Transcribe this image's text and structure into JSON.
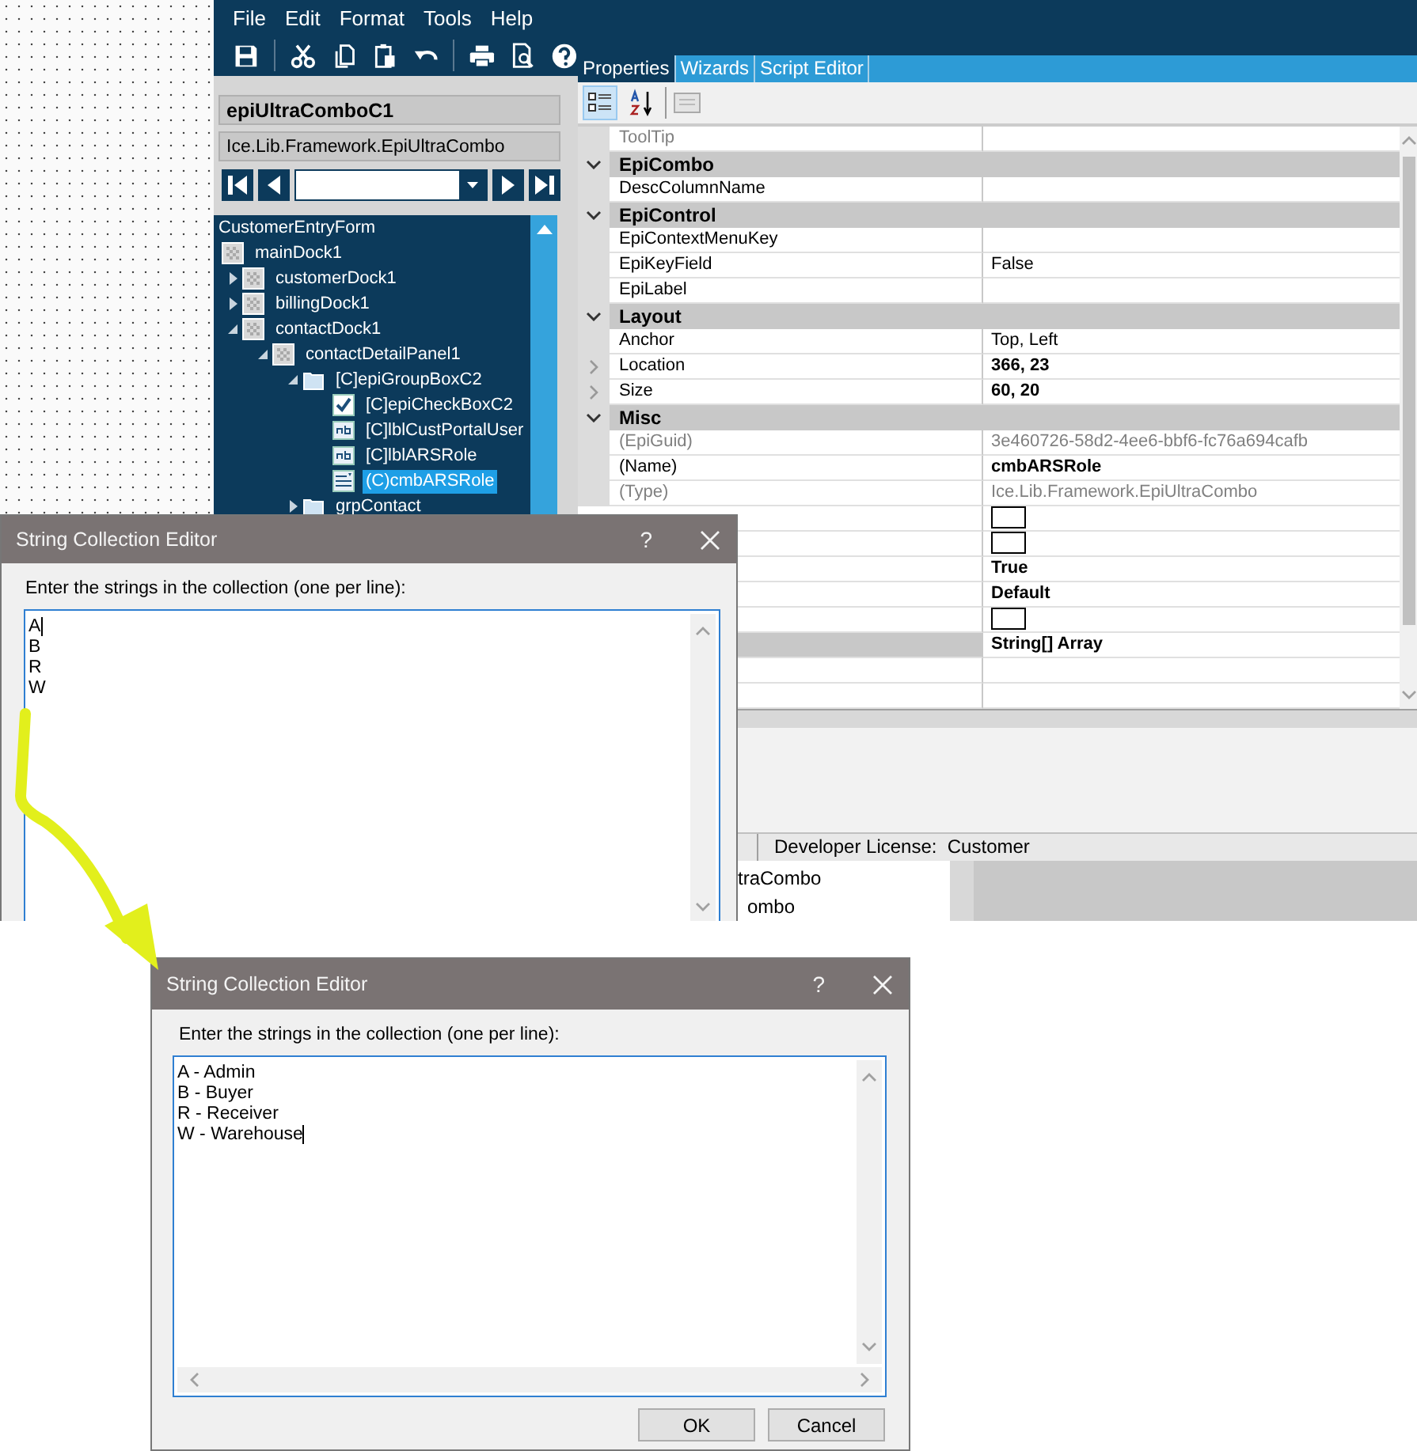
{
  "main_window": {
    "menu": [
      "File",
      "Edit",
      "Format",
      "Tools",
      "Help"
    ],
    "control_name": "epiUltraComboC1",
    "control_type": "Ice.Lib.Framework.EpiUltraCombo",
    "tree": [
      {
        "label": "CustomerEntryForm",
        "selected": false,
        "children": [
          {
            "label": "mainDock1",
            "kind": "dock",
            "selected": false,
            "children": [
              {
                "label": "customerDock1",
                "kind": "dock",
                "expanded": false,
                "selected": false
              },
              {
                "label": "billingDock1",
                "kind": "dock",
                "expanded": false,
                "selected": false
              },
              {
                "label": "contactDock1",
                "kind": "dock",
                "expanded": true,
                "selected": false,
                "children": [
                  {
                    "label": "contactDetailPanel1",
                    "kind": "dock",
                    "expanded": true,
                    "selected": false,
                    "children": [
                      {
                        "label": "[C]epiGroupBoxC2",
                        "kind": "group",
                        "expanded": true,
                        "selected": false,
                        "children": [
                          {
                            "label": "[C]epiCheckBoxC2",
                            "kind": "checkbox",
                            "selected": false
                          },
                          {
                            "label": "[C]lblCustPortalUser",
                            "kind": "label",
                            "selected": false
                          },
                          {
                            "label": "[C]lblARSRole",
                            "kind": "label",
                            "selected": false
                          },
                          {
                            "label": "(C)cmbARSRole",
                            "kind": "combo",
                            "selected": true
                          }
                        ]
                      },
                      {
                        "label": "grpContact",
                        "kind": "group",
                        "expanded": false,
                        "selected": false
                      }
                    ]
                  }
                ]
              }
            ]
          }
        ]
      }
    ],
    "tabs": [
      {
        "label": "Properties",
        "selected": true
      },
      {
        "label": "Wizards",
        "selected": false
      },
      {
        "label": "Script Editor",
        "selected": false
      }
    ],
    "view_buttons": [
      {
        "kind": "categorized",
        "selected": true
      },
      {
        "kind": "alphabetical",
        "selected": false
      }
    ],
    "properties": [
      {
        "kind": "property",
        "name": "ToolTip",
        "readonly": true,
        "expandable": false,
        "selected": false
      },
      {
        "kind": "category",
        "name": "EpiCombo",
        "expanded": true
      },
      {
        "kind": "property",
        "name": "DescColumnName",
        "readonly": false,
        "expandable": false,
        "selected": false
      },
      {
        "kind": "category",
        "name": "EpiControl",
        "expanded": true
      },
      {
        "kind": "property",
        "name": "EpiContextMenuKey",
        "readonly": false,
        "expandable": false,
        "selected": false
      },
      {
        "kind": "property",
        "name": "EpiKeyField",
        "value": "False",
        "readonly": false,
        "modified": false,
        "expandable": false,
        "selected": false
      },
      {
        "kind": "property",
        "name": "EpiLabel",
        "readonly": false,
        "expandable": false,
        "selected": false
      },
      {
        "kind": "category",
        "name": "Layout",
        "expanded": true
      },
      {
        "kind": "property",
        "name": "Anchor",
        "value": "Top, Left",
        "readonly": false,
        "modified": false,
        "expandable": false,
        "selected": false
      },
      {
        "kind": "property",
        "name": "Location",
        "value": "366, 23",
        "readonly": false,
        "modified": true,
        "expandable": true,
        "selected": false
      },
      {
        "kind": "property",
        "name": "Size",
        "value": "60, 20",
        "readonly": false,
        "modified": true,
        "expandable": true,
        "selected": false
      },
      {
        "kind": "category",
        "name": "Misc",
        "expanded": true
      },
      {
        "kind": "property",
        "name": "(EpiGuid)",
        "value": "3e460726-58d2-4ee6-bbf6-fc76a694cafb",
        "readonly": true,
        "modified": false,
        "expandable": false,
        "selected": false
      },
      {
        "kind": "property",
        "name": "(Name)",
        "value": "cmbARSRole",
        "readonly": false,
        "modified": true,
        "expandable": false,
        "selected": false
      },
      {
        "kind": "property",
        "name": "(Type)",
        "value": "Ice.Lib.Framework.EpiUltraCombo",
        "readonly": true,
        "modified": false,
        "expandable": false,
        "selected": false
      },
      {
        "kind": "swatch",
        "selected": false
      },
      {
        "kind": "swatch",
        "selected": false
      },
      {
        "kind": "property",
        "value": "True",
        "modified": true,
        "selected": false
      },
      {
        "kind": "property",
        "value": "Default",
        "modified": true,
        "selected": false
      },
      {
        "kind": "swatch",
        "selected": false
      },
      {
        "kind": "property",
        "value": "String[] Array",
        "modified": true,
        "selected": true
      },
      {
        "kind": "property",
        "selected": false
      },
      {
        "kind": "property",
        "selected": false
      }
    ],
    "status_bar": "Developer License:  Customer",
    "list_items": [
      "traCombo",
      "ombo"
    ]
  },
  "dialogs": [
    {
      "title": "String Collection Editor",
      "help_button": "?",
      "prompt": "Enter the strings in the collection (one per line):",
      "lines": [
        {
          "text": "A",
          "caret": true
        },
        {
          "text": "B",
          "caret": false
        },
        {
          "text": "R",
          "caret": false
        },
        {
          "text": "W",
          "caret": false
        }
      ]
    },
    {
      "title": "String Collection Editor",
      "help_button": "?",
      "prompt": "Enter the strings in the collection (one per line):",
      "lines": [
        {
          "text": "A - Admin",
          "caret": false
        },
        {
          "text": "B - Buyer",
          "caret": false
        },
        {
          "text": "R - Receiver",
          "caret": false
        },
        {
          "text": "W - Warehouse",
          "caret": true
        }
      ],
      "buttons": [
        "OK",
        "Cancel"
      ]
    }
  ]
}
